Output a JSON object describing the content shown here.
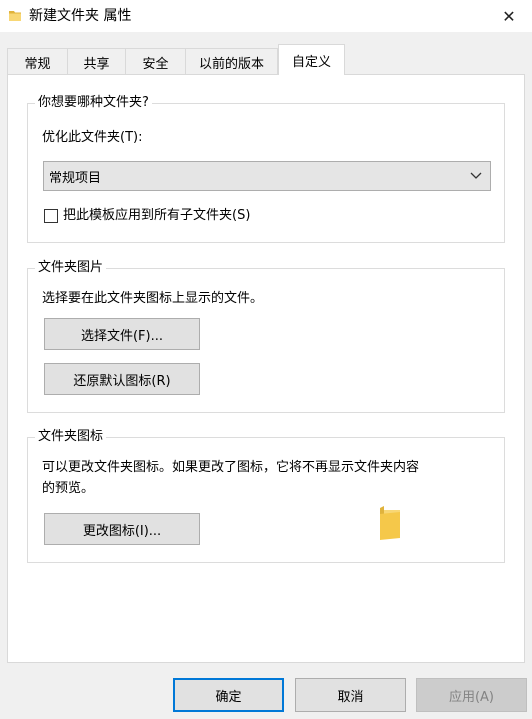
{
  "window": {
    "title": "新建文件夹 属性",
    "close_symbol": "✕"
  },
  "tabs": [
    {
      "label": "常规"
    },
    {
      "label": "共享"
    },
    {
      "label": "安全"
    },
    {
      "label": "以前的版本"
    },
    {
      "label": "自定义",
      "active": true
    }
  ],
  "folder_type": {
    "group_title": "你想要哪种文件夹?",
    "optimize_label": "优化此文件夹(T):",
    "selected_option": "常规项目",
    "apply_subfolders_label": "把此模板应用到所有子文件夹(S)",
    "apply_subfolders_checked": false
  },
  "folder_pictures": {
    "group_title": "文件夹图片",
    "description": "选择要在此文件夹图标上显示的文件。",
    "choose_file_button": "选择文件(F)...",
    "restore_default_button": "还原默认图标(R)"
  },
  "folder_icons": {
    "group_title": "文件夹图标",
    "description_line1": "可以更改文件夹图标。如果更改了图标，它将不再显示文件夹内容",
    "description_line2": "的预览。",
    "change_icon_button": "更改图标(I)..."
  },
  "footer": {
    "ok": "确定",
    "cancel": "取消",
    "apply": "应用(A)"
  },
  "colors": {
    "folder_yellow": "#f8d775",
    "folder_dark": "#e0b33c",
    "focus_blue": "#0078d7"
  }
}
